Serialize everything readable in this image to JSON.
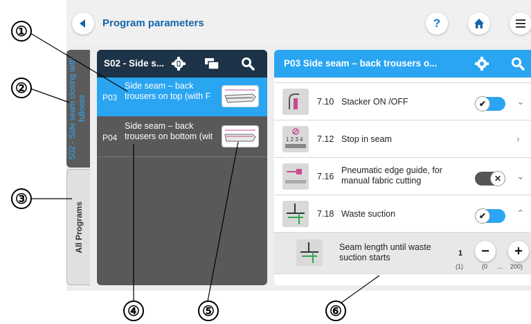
{
  "header": {
    "title": "Program parameters",
    "help_label": "?"
  },
  "side_tabs": [
    {
      "label": "S02 - Side seam closing with fullness",
      "active": true
    },
    {
      "label": "All Programs",
      "active": false
    }
  ],
  "program_list": {
    "title": "S02 - Side s...",
    "items": [
      {
        "code": "P03",
        "name": "Side seam – back trousers on top (with F",
        "selected": true
      },
      {
        "code": "P04",
        "name": "Side seam – back trousers on bottom (wit",
        "selected": false
      }
    ]
  },
  "parameters": {
    "title": "P03 Side seam – back trousers o...",
    "rows": [
      {
        "number": "7.10",
        "label": "Stacker ON /OFF",
        "control": "toggle",
        "state": "on",
        "chevron": "down"
      },
      {
        "number": "7.12",
        "label": "Stop in seam",
        "control": "none",
        "chevron": "right"
      },
      {
        "number": "7.16",
        "label": "Pneumatic edge guide, for manual fabric cutting",
        "control": "toggle",
        "state": "off",
        "chevron": "down"
      },
      {
        "number": "7.18",
        "label": "Waste suction",
        "control": "toggle",
        "state": "on",
        "chevron": "up"
      }
    ],
    "sub_row": {
      "label": "Seam length until waste suction starts",
      "value": "1",
      "default": "(1)",
      "min": "(0",
      "ellipsis": "...",
      "max": "200)",
      "minus_label": "−",
      "plus_label": "+"
    }
  },
  "callouts": [
    "①",
    "②",
    "③",
    "④",
    "⑤",
    "⑥"
  ],
  "colors": {
    "accent": "#2aa5f2",
    "dark_header": "#1d3347",
    "title_blue": "#1565a8",
    "panel_gray": "#595959"
  }
}
